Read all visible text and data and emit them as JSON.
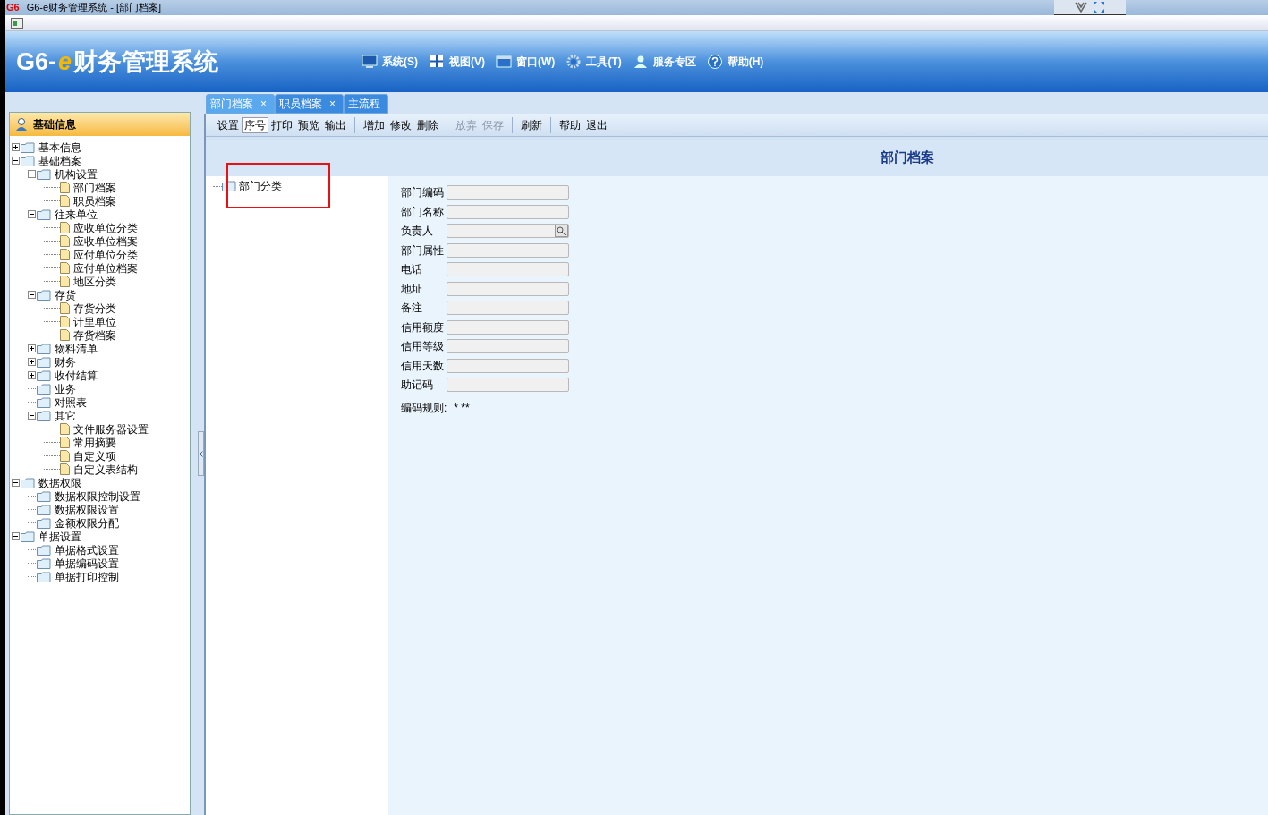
{
  "window": {
    "title": "G6-e财务管理系统 - [部门档案]",
    "logo": "G6"
  },
  "banner": {
    "brand_prefix": "G6-",
    "brand_e": "e",
    "brand_name": "财务管理系统"
  },
  "menu": [
    {
      "label": "系统(S)"
    },
    {
      "label": "视图(V)"
    },
    {
      "label": "窗口(W)"
    },
    {
      "label": "工具(T)"
    },
    {
      "label": "服务专区"
    },
    {
      "label": "帮助(H)"
    }
  ],
  "sidebar": {
    "title": "基础信息",
    "tree": [
      {
        "label": "基本信息",
        "kind": "folder",
        "expanded": false
      },
      {
        "label": "基础档案",
        "kind": "folder",
        "expanded": true,
        "children": [
          {
            "label": "机构设置",
            "kind": "folder",
            "expanded": true,
            "children": [
              {
                "label": "部门档案",
                "kind": "doc"
              },
              {
                "label": "职员档案",
                "kind": "doc"
              }
            ]
          },
          {
            "label": "往来单位",
            "kind": "folder",
            "expanded": true,
            "children": [
              {
                "label": "应收单位分类",
                "kind": "doc"
              },
              {
                "label": "应收单位档案",
                "kind": "doc"
              },
              {
                "label": "应付单位分类",
                "kind": "doc"
              },
              {
                "label": "应付单位档案",
                "kind": "doc"
              },
              {
                "label": "地区分类",
                "kind": "doc"
              }
            ]
          },
          {
            "label": "存货",
            "kind": "folder",
            "expanded": true,
            "children": [
              {
                "label": "存货分类",
                "kind": "doc"
              },
              {
                "label": "计里单位",
                "kind": "doc"
              },
              {
                "label": "存货档案",
                "kind": "doc"
              }
            ]
          },
          {
            "label": "物料清单",
            "kind": "folder",
            "expanded": false
          },
          {
            "label": "财务",
            "kind": "folder",
            "expanded": false
          },
          {
            "label": "收付结算",
            "kind": "folder",
            "expanded": false
          },
          {
            "label": "业务",
            "kind": "folder"
          },
          {
            "label": "对照表",
            "kind": "folder"
          },
          {
            "label": "其它",
            "kind": "folder",
            "expanded": true,
            "children": [
              {
                "label": "文件服务器设置",
                "kind": "doc"
              },
              {
                "label": "常用摘要",
                "kind": "doc"
              },
              {
                "label": "自定义项",
                "kind": "doc"
              },
              {
                "label": "自定义表结构",
                "kind": "doc"
              }
            ]
          }
        ]
      },
      {
        "label": "数据权限",
        "kind": "folder",
        "expanded": true,
        "children": [
          {
            "label": "数据权限控制设置",
            "kind": "folder"
          },
          {
            "label": "数据权限设置",
            "kind": "folder"
          },
          {
            "label": "金额权限分配",
            "kind": "folder"
          }
        ]
      },
      {
        "label": "单据设置",
        "kind": "folder",
        "expanded": true,
        "children": [
          {
            "label": "单据格式设置",
            "kind": "folder"
          },
          {
            "label": "单据编码设置",
            "kind": "folder"
          },
          {
            "label": "单据打印控制",
            "kind": "folder"
          }
        ]
      }
    ]
  },
  "tabs": [
    {
      "label": "部门档案",
      "close": "×",
      "selected": true
    },
    {
      "label": "职员档案",
      "close": "×",
      "selected": false
    },
    {
      "label": "主流程",
      "selected": false
    }
  ],
  "toolbar": [
    [
      {
        "label": "设置",
        "disabled": false,
        "selected": false
      },
      {
        "label": "序号",
        "disabled": false,
        "selected": true
      },
      {
        "label": "打印",
        "disabled": false,
        "selected": false
      },
      {
        "label": "预览",
        "disabled": false,
        "selected": false
      },
      {
        "label": "输出",
        "disabled": false,
        "selected": false
      }
    ],
    [
      {
        "label": "增加",
        "disabled": false,
        "selected": false
      },
      {
        "label": "修改",
        "disabled": false,
        "selected": false
      },
      {
        "label": "删除",
        "disabled": false,
        "selected": false
      }
    ],
    [
      {
        "label": "放弃",
        "disabled": true,
        "selected": false
      },
      {
        "label": "保存",
        "disabled": true,
        "selected": false
      }
    ],
    [
      {
        "label": "刷新",
        "disabled": false,
        "selected": false
      }
    ],
    [
      {
        "label": "帮助",
        "disabled": false,
        "selected": false
      },
      {
        "label": "退出",
        "disabled": false,
        "selected": false
      }
    ]
  ],
  "page_title": "部门档案",
  "category_tree": {
    "root": "部门分类",
    "highlighted": true
  },
  "form": {
    "fields": [
      {
        "label": "部门编码",
        "kind": "text"
      },
      {
        "label": "部门名称",
        "kind": "text"
      },
      {
        "label": "负责人",
        "kind": "lookup"
      },
      {
        "label": "部门属性",
        "kind": "text"
      },
      {
        "label": "电话",
        "kind": "text"
      },
      {
        "label": "地址",
        "kind": "text"
      },
      {
        "label": "备注",
        "kind": "text"
      },
      {
        "label": "信用额度",
        "kind": "text"
      },
      {
        "label": "信用等级",
        "kind": "text"
      },
      {
        "label": "信用天数",
        "kind": "text"
      },
      {
        "label": "助记码",
        "kind": "text"
      }
    ],
    "rule_label": "编码规则:",
    "rule_value": "* **"
  }
}
